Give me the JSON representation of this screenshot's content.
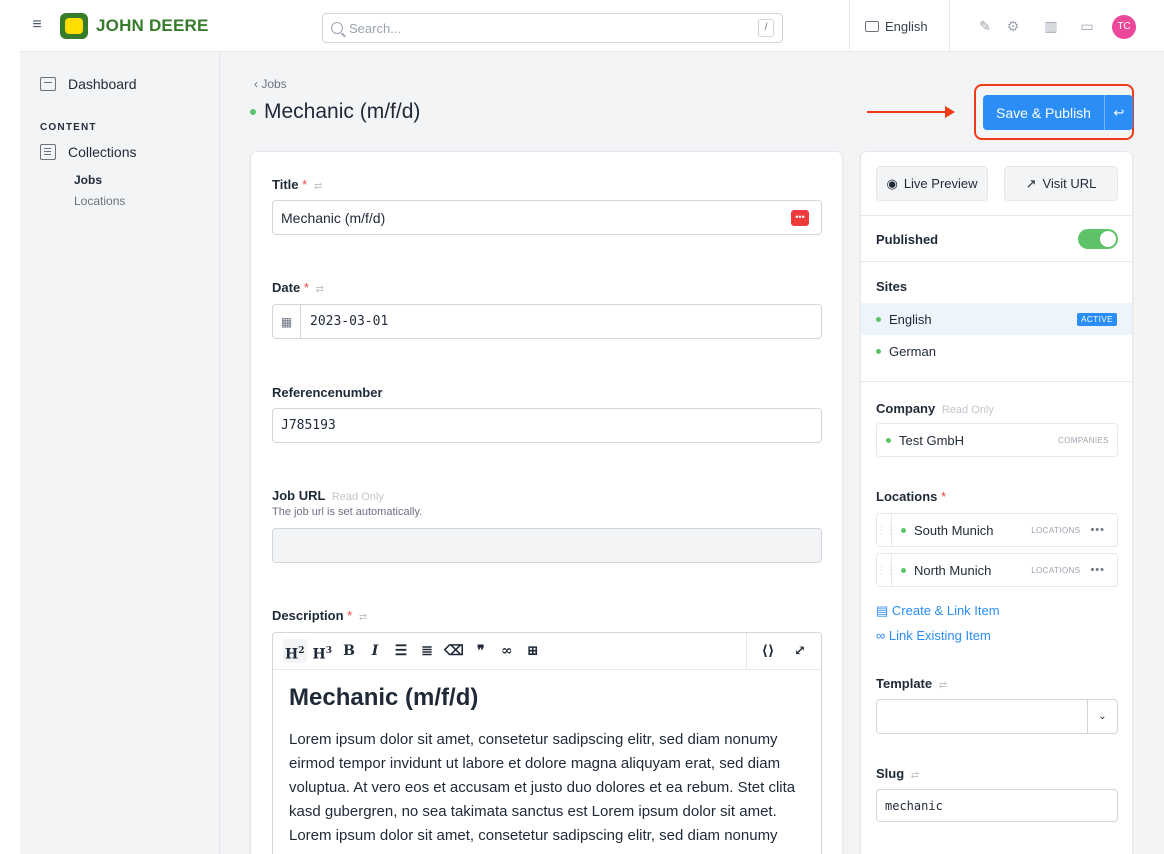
{
  "topbar": {
    "brand": "JOHN DEERE",
    "search_placeholder": "Search...",
    "search_shortcut": "/",
    "site_label": "English",
    "avatar_initials": "TC"
  },
  "sidebar": {
    "dashboard": "Dashboard",
    "section": "CONTENT",
    "collections": "Collections",
    "items": [
      {
        "label": "Jobs",
        "active": true
      },
      {
        "label": "Locations",
        "active": false
      }
    ]
  },
  "header": {
    "breadcrumb": "‹ Jobs",
    "title": "Mechanic (m/f/d)",
    "publish_label": "Save & Publish",
    "publish_caret": "↩"
  },
  "form": {
    "title": {
      "label": "Title",
      "value": "Mechanic (m/f/d)"
    },
    "date": {
      "label": "Date",
      "value": "2023-03-01"
    },
    "reference": {
      "label": "Referencenumber",
      "value": "J785193"
    },
    "job_url": {
      "label": "Job URL",
      "readonly": "Read Only",
      "help": "The job url is set automatically.",
      "value": ""
    },
    "description": {
      "label": "Description",
      "heading": "Mechanic (m/f/d)",
      "body": "Lorem ipsum dolor sit amet, consetetur sadipscing elitr, sed diam nonumy eirmod tempor invidunt ut labore et dolore magna aliquyam erat, sed diam voluptua. At vero eos et accusam et justo duo dolores et ea rebum. Stet clita kasd gubergren, no sea takimata sanctus est Lorem ipsum dolor sit amet. Lorem ipsum dolor sit amet, consetetur sadipscing elitr, sed diam nonumy"
    }
  },
  "side": {
    "live_preview": "Live Preview",
    "visit_url": "Visit URL",
    "published_label": "Published",
    "published": true,
    "sites_label": "Sites",
    "sites": [
      {
        "name": "English",
        "badge": "ACTIVE"
      },
      {
        "name": "German",
        "badge": ""
      }
    ],
    "company": {
      "label": "Company",
      "readonly": "Read Only",
      "value": "Test GmbH",
      "tag": "COMPANIES"
    },
    "locations": {
      "label": "Locations",
      "items": [
        {
          "name": "South Munich",
          "tag": "LOCATIONS"
        },
        {
          "name": "North Munich",
          "tag": "LOCATIONS"
        }
      ],
      "create_link": "Create & Link Item",
      "link_existing": "Link Existing Item"
    },
    "template": {
      "label": "Template",
      "value": ""
    },
    "slug": {
      "label": "Slug",
      "value": "mechanic"
    }
  },
  "colors": {
    "accent": "#2b8ef7",
    "brand_green": "#367c2b",
    "brand_yellow": "#ffde00",
    "status_green": "#5ec269",
    "annotation_red": "#ef3b15"
  }
}
